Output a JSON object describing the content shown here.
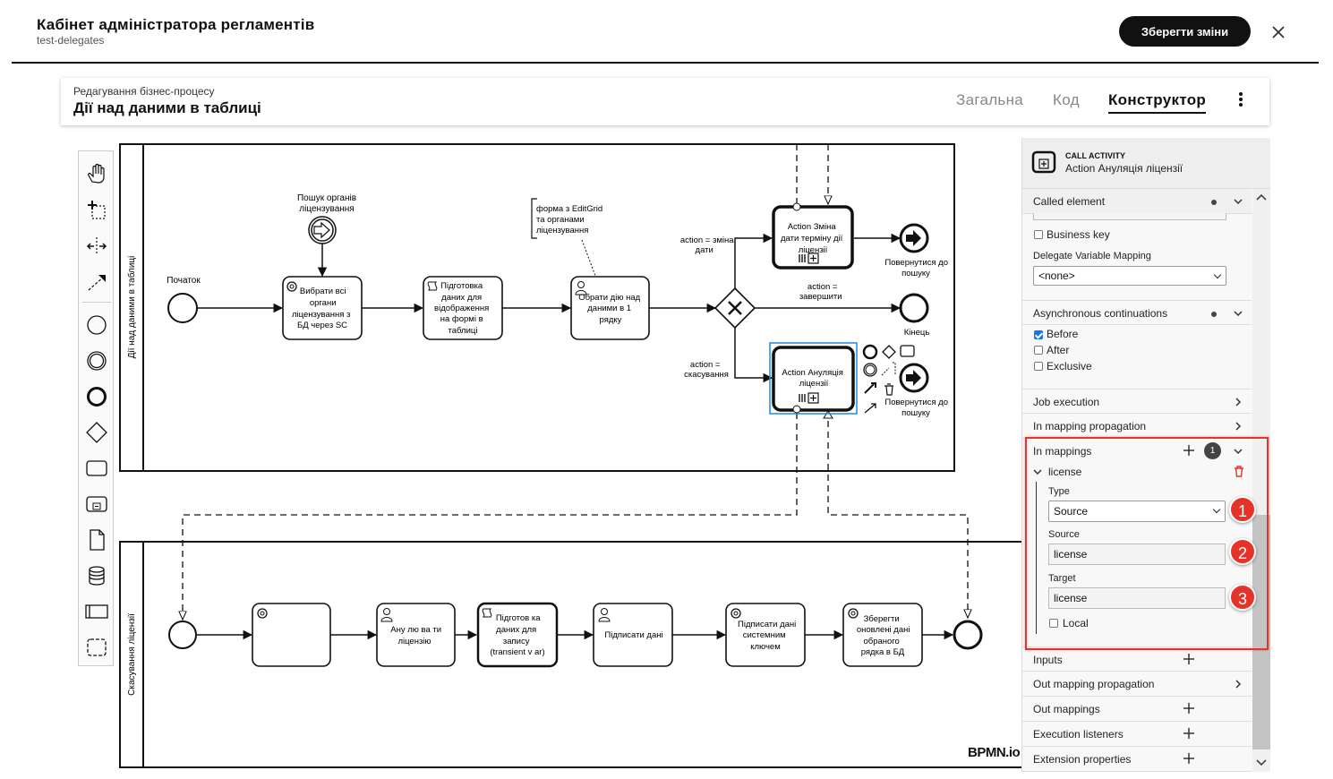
{
  "header": {
    "title": "Кабінет адміністратора регламентів",
    "subtitle": "test-delegates",
    "save_label": "Зберегти зміни"
  },
  "process": {
    "caption": "Редагування бізнес-процесу",
    "title": "Дії над даними в таблиці",
    "tabs": [
      {
        "label": "Загальна"
      },
      {
        "label": "Код"
      },
      {
        "label": "Конструктор",
        "active": true
      }
    ]
  },
  "palette": {
    "tools": [
      "hand-tool-icon",
      "lasso-tool-icon",
      "space-tool-icon",
      "connect-tool-icon",
      "start-event-icon",
      "intermediate-event-icon",
      "end-event-icon",
      "gateway-icon",
      "task-icon",
      "subprocess-icon",
      "data-object-icon",
      "data-store-icon",
      "pool-icon",
      "group-icon"
    ]
  },
  "diagram": {
    "lane1_label": "Дії над даними в таблиці",
    "lane2_label": "Скасування ліцензії",
    "start_label": "Початок",
    "event_search_label_1": "Пошук органів",
    "event_search_label_2": "ліцензування",
    "task_select_orgs": [
      "Вибрати всі",
      "органи",
      "ліцензування з",
      "БД через SC"
    ],
    "task_prepare_data": [
      "Підготовка",
      "даних для",
      "відображення",
      "на формі в",
      "таблиці"
    ],
    "annotation": [
      "форма з EditGrid",
      "та органами",
      "ліцензування"
    ],
    "task_choose_action": [
      "Обрати дію над",
      "даними в 1",
      "рядку"
    ],
    "flow_change_label": [
      "action = зміна",
      "дати"
    ],
    "flow_finish_label": [
      "action =",
      "завершити"
    ],
    "flow_cancel_label": [
      "action =",
      "скасування"
    ],
    "call_change": [
      "Action Зміна",
      "дати терміну дії",
      "ліцензії"
    ],
    "call_cancel": [
      "Action Ануляція",
      "ліцензії"
    ],
    "end_return_label": [
      "Повернутися до",
      "пошуку"
    ],
    "end_label": "Кінець",
    "task_cancel": [
      "Ану лю ва ти",
      "ліцензію"
    ],
    "task_prepare_write": [
      "Підготов ка",
      "даних для",
      "запису",
      "(transient v ar)"
    ],
    "task_sign": "Підписати дані",
    "task_sign_key": [
      "Підписати дані",
      "системним",
      "ключем"
    ],
    "task_save_changes": [
      "Зберегти",
      "оновлені дані",
      "обраного",
      "рядка в БД"
    ],
    "watermark": "BPMN.io"
  },
  "properties": {
    "element_type": "CALL ACTIVITY",
    "element_name": "Action Ануляція ліцензії",
    "groups": {
      "called_element": "Called element",
      "business_key": "Business key",
      "delegate_mapping_label": "Delegate Variable Mapping",
      "delegate_mapping_value": "<none>",
      "async": "Asynchronous continuations",
      "before": "Before",
      "after": "After",
      "exclusive": "Exclusive",
      "job_execution": "Job execution",
      "in_mapping_propagation": "In mapping propagation",
      "in_mappings": "In mappings",
      "in_mappings_count": "1",
      "mapping_name": "license",
      "type_label": "Type",
      "type_value": "Source",
      "source_label": "Source",
      "source_value": "license",
      "target_label": "Target",
      "target_value": "license",
      "local": "Local",
      "inputs": "Inputs",
      "out_mapping_propagation": "Out mapping propagation",
      "out_mappings": "Out mappings",
      "execution_listeners": "Execution listeners",
      "extension_properties": "Extension properties"
    },
    "callouts": [
      "1",
      "2",
      "3"
    ],
    "colors": {
      "highlight": "#e5332a",
      "checkbox": "#1a73e8",
      "selection": "#1e88e5"
    }
  }
}
